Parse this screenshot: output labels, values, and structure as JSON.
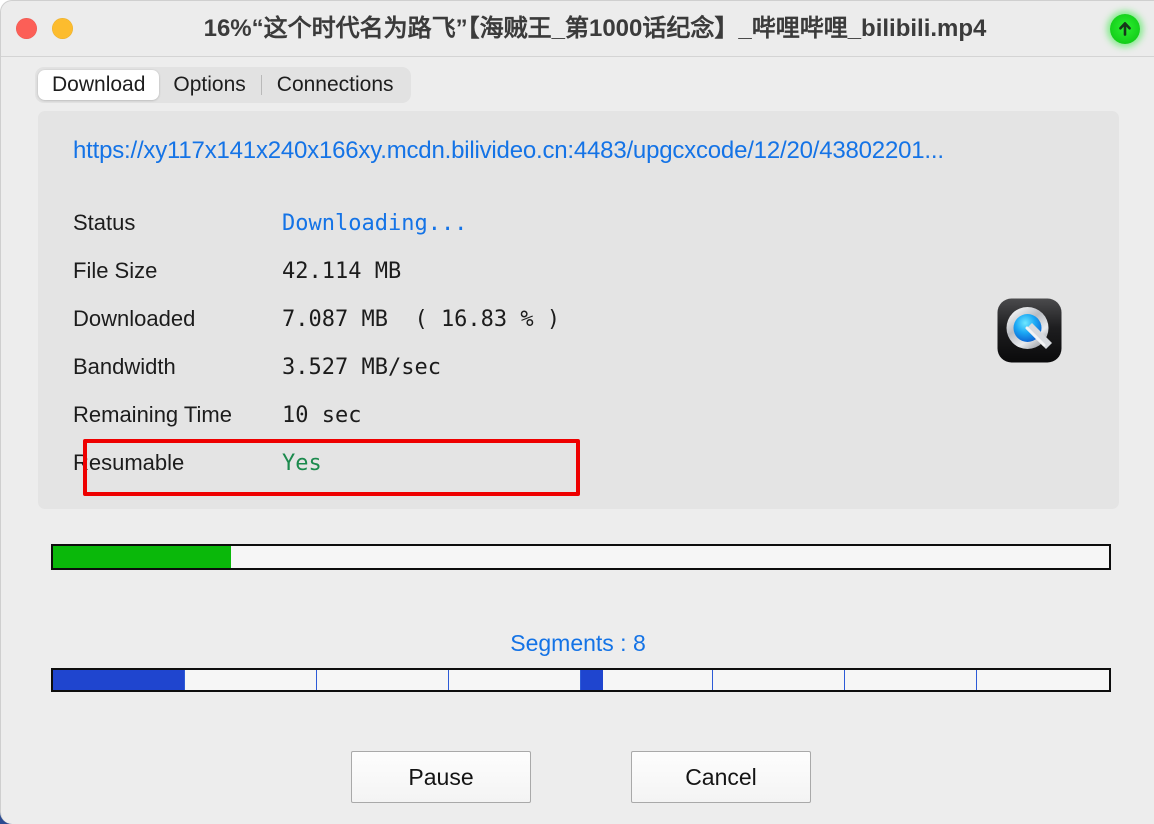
{
  "window": {
    "title": "16%“这个时代名为路飞”【海贼王_第1000话纪念】_哔哩哔哩_bilibili.mp4",
    "progress_percent": "16%",
    "traffic_lights": [
      {
        "name": "close",
        "color": "#fc5f57"
      },
      {
        "name": "minimize",
        "color": "#fcbc2e"
      }
    ],
    "badge_icon": "upload-arrow-icon",
    "badge_color": "#17d31d"
  },
  "tabs": [
    {
      "label": "Download",
      "active": true
    },
    {
      "label": "Options",
      "active": false
    },
    {
      "label": "Connections",
      "active": false
    }
  ],
  "details": {
    "url": "https://xy117x141x240x166xy.mcdn.bilivideo.cn:4483/upgcxcode/12/20/43802201...",
    "rows": [
      {
        "label": "Status",
        "value": "Downloading...",
        "style": "blue"
      },
      {
        "label": "File Size",
        "value": "42.114 MB",
        "style": "mono"
      },
      {
        "label": "Downloaded",
        "value": "7.087 MB  ( 16.83 % )",
        "style": "mono"
      },
      {
        "label": "Bandwidth",
        "value": "3.527 MB/sec",
        "style": "mono"
      },
      {
        "label": "Remaining Time",
        "value": "10 sec",
        "style": "mono"
      },
      {
        "label": "Resumable",
        "value": "Yes",
        "style": "green"
      }
    ],
    "app_icon": "quicktime-player-icon",
    "highlight_color": "#ee0000",
    "highlighted_row": "Bandwidth"
  },
  "progress": {
    "percent": 16.83,
    "fill_color": "#0ab80a",
    "track_color": "#f6f6f6"
  },
  "segments": {
    "label": "Segments : 8",
    "count": 8,
    "fill_color": "#1f45cf",
    "fills": [
      100,
      0,
      0,
      0,
      17,
      0,
      0,
      0
    ]
  },
  "buttons": {
    "pause": "Pause",
    "cancel": "Cancel"
  }
}
